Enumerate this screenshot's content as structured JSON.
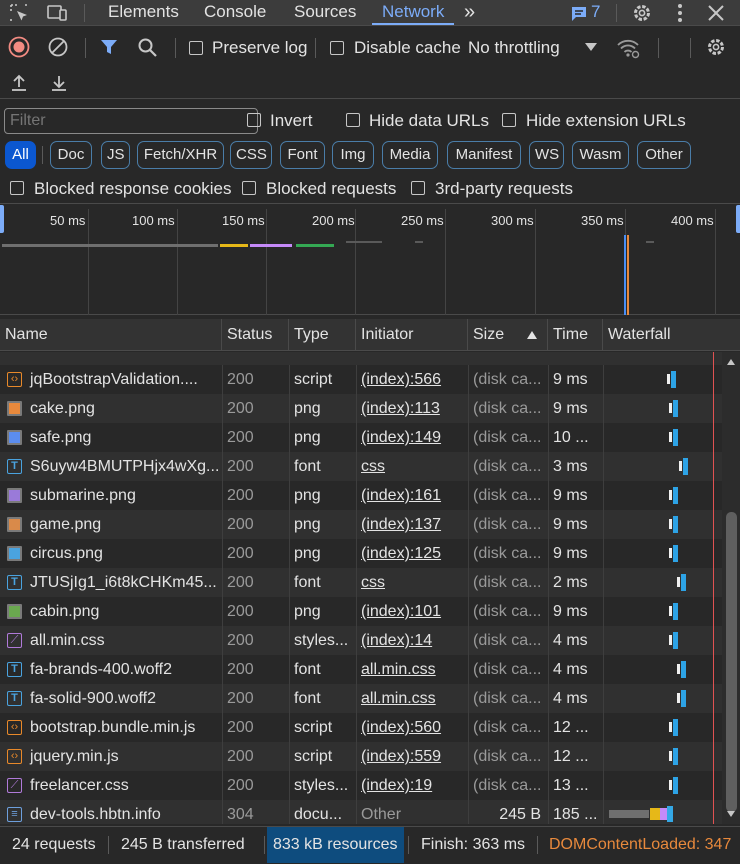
{
  "tabs": {
    "elements": "Elements",
    "console": "Console",
    "sources": "Sources",
    "network": "Network",
    "more": "»",
    "issues_count": "7"
  },
  "toolbar": {
    "preserve_log": "Preserve log",
    "disable_cache": "Disable cache",
    "throttling": "No throttling"
  },
  "filter": {
    "placeholder": "Filter",
    "invert": "Invert",
    "hide_data_urls": "Hide data URLs",
    "hide_extension_urls": "Hide extension URLs",
    "types": [
      "All",
      "Doc",
      "JS",
      "Fetch/XHR",
      "CSS",
      "Font",
      "Img",
      "Media",
      "Manifest",
      "WS",
      "Wasm",
      "Other"
    ],
    "blocked_cookies": "Blocked response cookies",
    "blocked_requests": "Blocked requests",
    "third_party": "3rd-party requests"
  },
  "overview": {
    "ticks": [
      "50 ms",
      "100 ms",
      "150 ms",
      "200 ms",
      "250 ms",
      "300 ms",
      "350 ms",
      "400 ms"
    ]
  },
  "columns": {
    "name": "Name",
    "status": "Status",
    "type": "Type",
    "initiator": "Initiator",
    "size": "Size",
    "time": "Time",
    "waterfall": "Waterfall"
  },
  "rows": [
    {
      "name": "jqBootstrapValidation....",
      "status": "200",
      "type": "script",
      "initiator": "(index):566",
      "size": "(disk ca...",
      "time": "9 ms",
      "icon": "script"
    },
    {
      "name": "cake.png",
      "status": "200",
      "type": "png",
      "initiator": "(index):113",
      "size": "(disk ca...",
      "time": "9 ms",
      "icon": "img"
    },
    {
      "name": "safe.png",
      "status": "200",
      "type": "png",
      "initiator": "(index):149",
      "size": "(disk ca...",
      "time": "10 ...",
      "icon": "img"
    },
    {
      "name": "S6uyw4BMUTPHjx4wXg...",
      "status": "200",
      "type": "font",
      "initiator": "css",
      "size": "(disk ca...",
      "time": "3 ms",
      "icon": "font"
    },
    {
      "name": "submarine.png",
      "status": "200",
      "type": "png",
      "initiator": "(index):161",
      "size": "(disk ca...",
      "time": "9 ms",
      "icon": "img"
    },
    {
      "name": "game.png",
      "status": "200",
      "type": "png",
      "initiator": "(index):137",
      "size": "(disk ca...",
      "time": "9 ms",
      "icon": "img"
    },
    {
      "name": "circus.png",
      "status": "200",
      "type": "png",
      "initiator": "(index):125",
      "size": "(disk ca...",
      "time": "9 ms",
      "icon": "img"
    },
    {
      "name": "JTUSjIg1_i6t8kCHKm45...",
      "status": "200",
      "type": "font",
      "initiator": "css",
      "size": "(disk ca...",
      "time": "2 ms",
      "icon": "font"
    },
    {
      "name": "cabin.png",
      "status": "200",
      "type": "png",
      "initiator": "(index):101",
      "size": "(disk ca...",
      "time": "9 ms",
      "icon": "img"
    },
    {
      "name": "all.min.css",
      "status": "200",
      "type": "styles...",
      "initiator": "(index):14",
      "size": "(disk ca...",
      "time": "4 ms",
      "icon": "css"
    },
    {
      "name": "fa-brands-400.woff2",
      "status": "200",
      "type": "font",
      "initiator": "all.min.css",
      "size": "(disk ca...",
      "time": "4 ms",
      "icon": "font"
    },
    {
      "name": "fa-solid-900.woff2",
      "status": "200",
      "type": "font",
      "initiator": "all.min.css",
      "size": "(disk ca...",
      "time": "4 ms",
      "icon": "font"
    },
    {
      "name": "bootstrap.bundle.min.js",
      "status": "200",
      "type": "script",
      "initiator": "(index):560",
      "size": "(disk ca...",
      "time": "12 ...",
      "icon": "script"
    },
    {
      "name": "jquery.min.js",
      "status": "200",
      "type": "script",
      "initiator": "(index):559",
      "size": "(disk ca...",
      "time": "12 ...",
      "icon": "script"
    },
    {
      "name": "freelancer.css",
      "status": "200",
      "type": "styles...",
      "initiator": "(index):19",
      "size": "(disk ca...",
      "time": "13 ...",
      "icon": "css"
    },
    {
      "name": "dev-tools.hbtn.info",
      "status": "304",
      "type": "docu...",
      "initiator": "Other",
      "size": "245 B",
      "time": "185 ...",
      "icon": "doc"
    }
  ],
  "status": {
    "requests": "24 requests",
    "transferred": "245 B transferred",
    "resources": "833 kB resources",
    "finish": "Finish: 363 ms",
    "dcl": "DOMContentLoaded: 347"
  },
  "colors": {
    "accent": "#7cacf8",
    "active_chip": "#0b57d0",
    "dcl": "#e8893c",
    "load_line": "#e05252"
  }
}
